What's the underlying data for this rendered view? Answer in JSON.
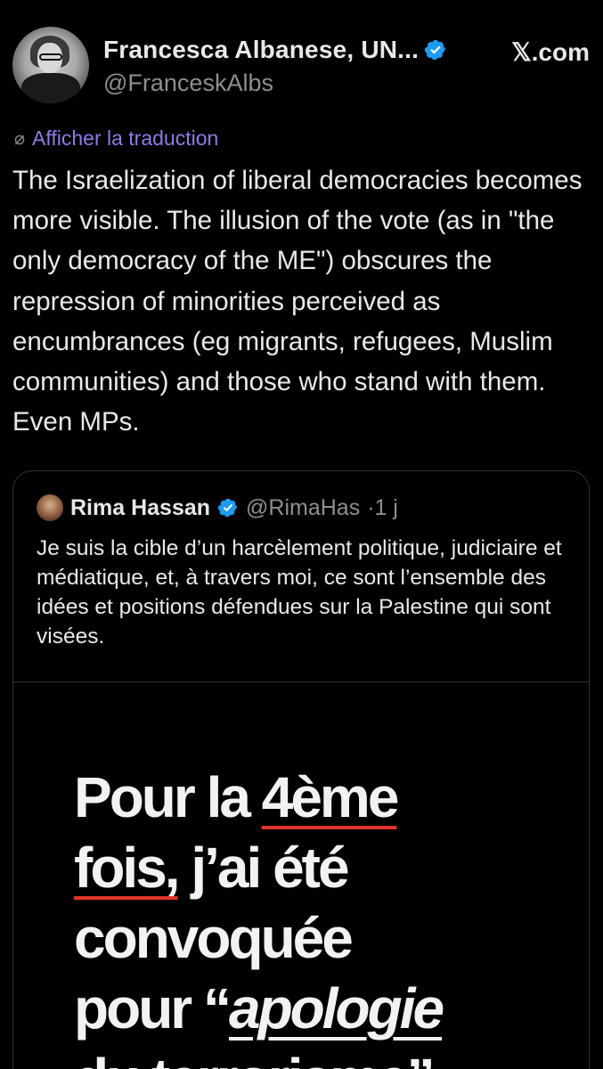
{
  "header": {
    "display_name": "Francesca Albanese, UN...",
    "handle": "@FranceskAlbs",
    "site": "𝕏.com"
  },
  "translate_label": "Afficher la traduction",
  "tweet_text": "The Israelization of liberal democracies becomes more visible. The illusion of the vote (as in \"the only democracy of the ME\") obscures the repression of minorities perceived as encumbrances (eg migrants, refugees, Muslim communities) and those who stand with them. Even MPs.",
  "quote": {
    "name": "Rima Hassan",
    "handle": "@RimaHas",
    "time": "·1 j",
    "text": "Je suis la cible d’un harcèlement politique, judiciaire et médiatique, et, à travers moi, ce sont l’ensemble des idées et positions défendues sur la Palestine qui sont visées."
  },
  "poster": {
    "l1a": "Pour la ",
    "l1b": "4ème",
    "l2a": "fois,",
    "l2b": " j’ai été",
    "l3": "convoquée",
    "l4a": "pour “",
    "l4b": "apologie",
    "l5": "du terrorisme”"
  },
  "colors": {
    "background": "#000000",
    "text": "#e7e9ea",
    "secondary": "#8b8f94",
    "link": "#8f7be8",
    "verified": "#1d9bf0",
    "underline_red": "#e0352b"
  },
  "icons": {
    "verified": "verified-badge-icon",
    "translate": "globe-icon"
  }
}
